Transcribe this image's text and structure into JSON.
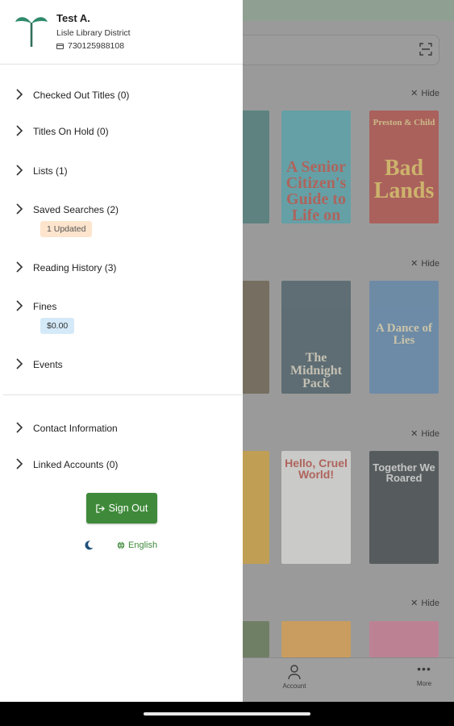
{
  "drawer": {
    "user_name": "Test A.",
    "library": "Lisle Library District",
    "card_number": "730125988108",
    "menu": [
      {
        "label": "Checked Out Titles (0)"
      },
      {
        "label": "Titles On Hold (0)"
      },
      {
        "label": "Lists (1)"
      },
      {
        "label": "Saved Searches (2)",
        "badge": "1 Updated"
      },
      {
        "label": "Reading History (3)"
      },
      {
        "label": "Fines",
        "badge": "$0.00"
      },
      {
        "label": "Events"
      }
    ],
    "secondary_menu": [
      {
        "label": "Contact Information"
      },
      {
        "label": "Linked Accounts (0)"
      }
    ],
    "sign_out_label": "Sign Out",
    "language": "English",
    "icons": {
      "logo": "sprout-logo-icon",
      "card": "library-card-icon",
      "chevron": "chevron-right-icon",
      "sign_out": "sign-out-icon",
      "theme": "moon-icon",
      "language": "globe-icon"
    },
    "colors": {
      "accent": "#3f8a3a",
      "badge_orange": "#fde4cc",
      "badge_blue": "#d5eaf8"
    }
  },
  "background": {
    "hide_label": "Hide",
    "books": [
      {
        "title": "A Senior Citizen's Guide to Life on the Run"
      },
      {
        "title": "Bad Lands",
        "author": "Preston & Child"
      },
      {
        "title": "The Midnight Pack"
      },
      {
        "title": "A Dance of Lies"
      },
      {
        "title": "Hello, Cruel World!"
      },
      {
        "title": "Together We Roared"
      }
    ],
    "tabs": {
      "account": "Account",
      "more": "More"
    }
  }
}
